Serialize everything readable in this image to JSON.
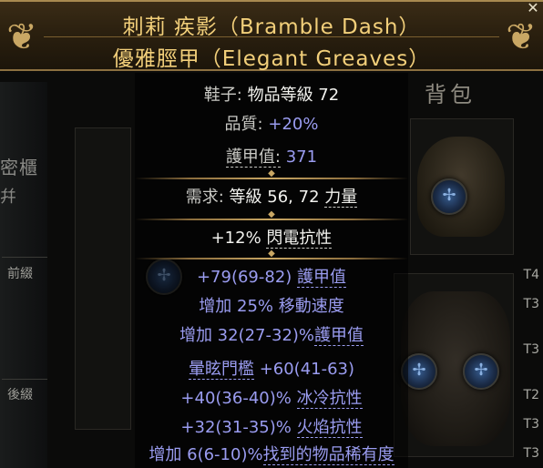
{
  "background": {
    "stash_label": "密櫃",
    "stash_label2": "幷",
    "prefix_label": "前綴",
    "suffix_label": "後綴",
    "bag_label": "背包",
    "tiers": [
      "T4",
      "T3",
      "T3",
      "T2",
      "T3",
      "T3"
    ]
  },
  "item": {
    "name": "刺莉 疾影（Bramble Dash）",
    "base_type": "優雅脛甲（Elegant Greaves）",
    "item_class_label": "鞋子:",
    "item_level_text": "物品等級 72",
    "quality_label": "品質:",
    "quality_value": "+20%",
    "armour_label": "護甲值:",
    "armour_value": "371",
    "requires_label": "需求:",
    "requires_value": "等級 56, 72",
    "requires_attr": "力量",
    "implicit": {
      "prefix": "+12%",
      "name": "閃電抗性"
    },
    "mods": [
      {
        "pre": "+79(69-82)",
        "name": "護甲值",
        "post": ""
      },
      {
        "pre": "增加 25%",
        "name": "移動速度",
        "post": ""
      },
      {
        "pre": "增加 32(27-32)%",
        "name": "護甲值",
        "post": ""
      },
      {
        "pre": "",
        "name": "暈眩門檻",
        "post": " +60(41-63)"
      },
      {
        "pre": "+40(36-40)%",
        "name": "冰冷抗性",
        "post": ""
      },
      {
        "pre": "+32(31-35)%",
        "name": "火焰抗性",
        "post": ""
      },
      {
        "pre": "增加 6(6-10)%",
        "name": "找到的物品稀有度",
        "post": ""
      }
    ]
  },
  "colors": {
    "unique_name": "#f2cf7a",
    "magic_blue": "#9a9cf0",
    "header_bg": "#2b200f"
  }
}
